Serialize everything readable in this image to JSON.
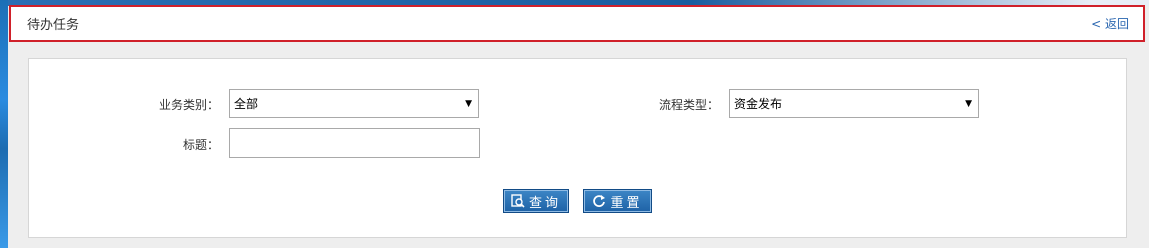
{
  "header": {
    "title": "待办任务",
    "back_label": "< 返回"
  },
  "form": {
    "business_type_label": "业务类别：",
    "business_type_value": "全部",
    "process_type_label": "流程类型：",
    "process_type_value": "资金发布",
    "title_label": "标题：",
    "title_value": ""
  },
  "buttons": {
    "search_label": "查询",
    "reset_label": "重置"
  }
}
